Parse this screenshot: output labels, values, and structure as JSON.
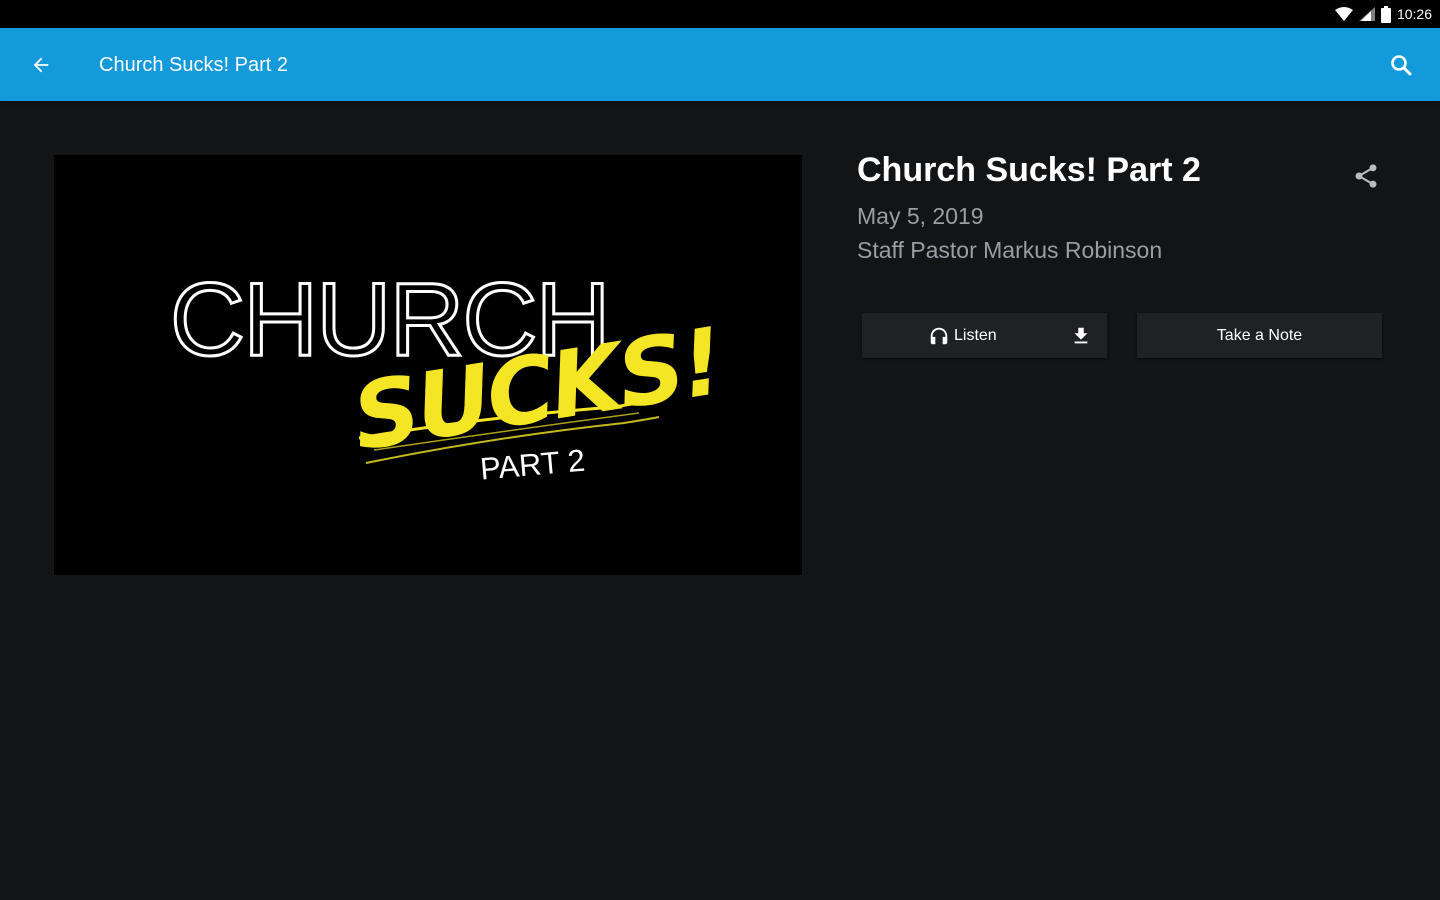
{
  "status_bar": {
    "time": "10:26",
    "icons": [
      "wifi-icon",
      "signal-icon",
      "battery-icon"
    ]
  },
  "app_bar": {
    "title": "Church Sucks! Part 2",
    "back_icon": "arrow-left-icon",
    "search_icon": "search-icon",
    "color": "#129adb"
  },
  "artwork": {
    "line1": "CHURCH",
    "line2": "SUCKS!",
    "line3": "PART 2",
    "accent_color": "#f5e625"
  },
  "sermon": {
    "title": "Church Sucks! Part 2",
    "date": "May 5, 2019",
    "speaker": "Staff Pastor Markus Robinson",
    "share_icon": "share-icon"
  },
  "actions": {
    "listen_label": "Listen",
    "listen_icon": "headphones-icon",
    "download_icon": "download-icon",
    "note_label": "Take a Note"
  }
}
